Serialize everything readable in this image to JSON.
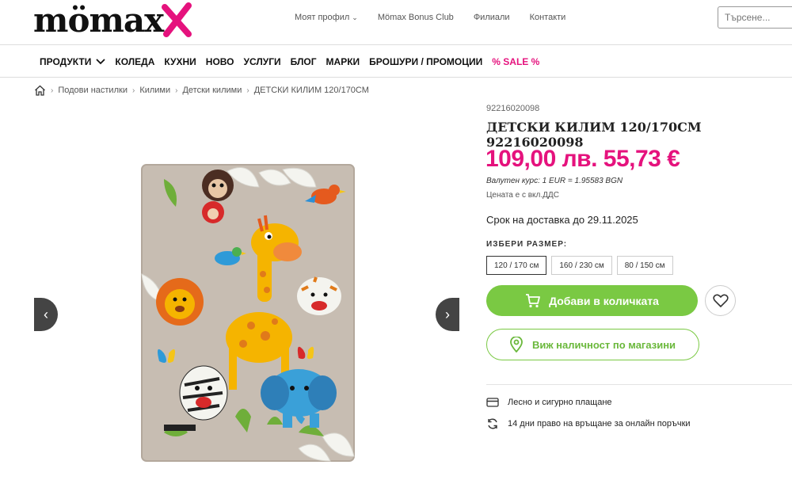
{
  "header": {
    "logo_text": "mömax",
    "top_links": [
      "Моят профил",
      "Mömax Bonus Club",
      "Филиали",
      "Контакти"
    ],
    "search_placeholder": "Търсене...",
    "nav": [
      "ПРОДУКТИ",
      "КОЛЕДА",
      "КУХНИ",
      "НОВО",
      "УСЛУГИ",
      "БЛОГ",
      "МАРКИ",
      "БРОШУРИ / ПРОМОЦИИ",
      "% SALE %"
    ]
  },
  "breadcrumb": [
    "Подови настилки",
    "Килими",
    "Детски килими",
    "ДЕТСКИ КИЛИМ 120/170СМ"
  ],
  "product": {
    "sku": "92216020098",
    "title": "ДЕТСКИ КИЛИМ 120/170СМ 92216020098",
    "price": "109,00 лв. 55,73 €",
    "exchange_rate": "Валутен курс: 1 EUR = 1.95583 BGN",
    "vat_note": "Цената е с вкл.ДДС",
    "delivery": "Срок на доставка до 29.11.2025",
    "size_label": "ИЗБЕРИ РАЗМЕР:",
    "sizes": [
      "120 / 170 см",
      "160 / 230 см",
      "80 / 150 см"
    ],
    "selected_size": "120 / 170 см",
    "add_to_cart": "Добави в количката",
    "store_availability": "Виж наличност по магазини",
    "perks": [
      "Лесно и сигурно плащане",
      "14 дни право на връщане за онлайн поръчки"
    ]
  },
  "colors": {
    "accent_pink": "#e5127d",
    "accent_green": "#7ac943"
  }
}
